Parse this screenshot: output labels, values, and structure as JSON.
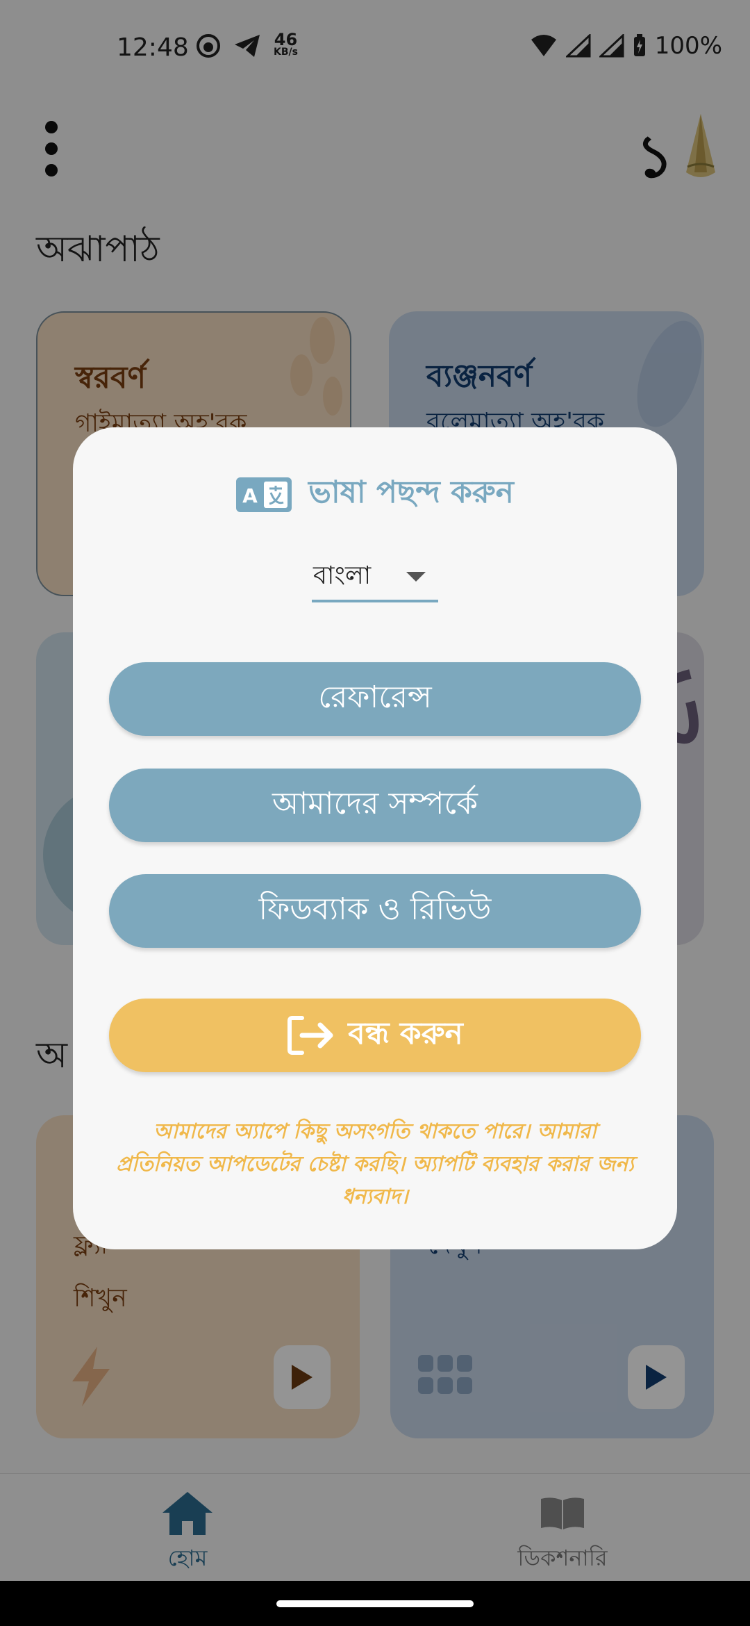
{
  "status_bar": {
    "time": "12:48",
    "net_speed_value": "46",
    "net_speed_unit": "KB/s",
    "battery": "100%"
  },
  "app_bar": {
    "counter": "১"
  },
  "section1": {
    "title": "অঝাপাঠ",
    "cards": [
      {
        "title": "স্বরবর্ণ",
        "subtitle": "গাইমাত্যা অহ'রক"
      },
      {
        "title": "ব্যঞ্জনবর্ণ",
        "subtitle": "বলেমাত্যা অহ'রক"
      }
    ]
  },
  "section2": {
    "title": "অ",
    "cards": [
      {
        "title": "ফ্ল",
        "subtitle_line1": "ফ্ল্যা",
        "subtitle_line2": "শিখুন"
      },
      {
        "title": "",
        "subtitle_line1": "",
        "subtitle_line2": "দেখুন"
      }
    ]
  },
  "bottom_nav": {
    "home": "হোম",
    "dictionary": "ডিকশনারি"
  },
  "dialog": {
    "title": "ভাষা পছন্দ করুন",
    "language_selected": "বাংলা",
    "reference_button": "রেফারেন্স",
    "about_button": "আমাদের সম্পর্কে",
    "feedback_button": "ফিডব্যাক ও রিভিউ",
    "close_button": "বন্ধ করুন",
    "note": "আমাদের অ্যাপে কিছু অসংগতি থাকতে পারে। আমারা প্রতিনিয়ত আপডেটের চেষ্টা করছি। অ্যাপটি ব্যবহার করার জন্য ধন্যবাদ।"
  },
  "colors": {
    "accent_blue": "#7da8bd",
    "accent_yellow": "#f0c162",
    "note_text": "#f0b84a",
    "title_blue": "#79a8c0"
  }
}
